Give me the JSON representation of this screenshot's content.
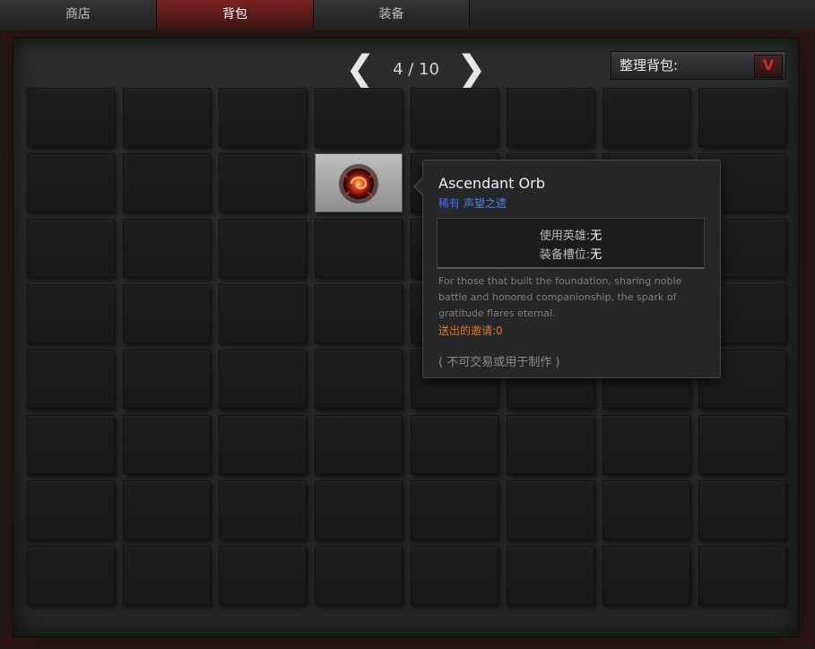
{
  "tabs": [
    {
      "label": "商店",
      "active": false
    },
    {
      "label": "背包",
      "active": true
    },
    {
      "label": "装备",
      "active": false
    }
  ],
  "pager": {
    "prev": "❮",
    "next": "❯",
    "label": "4 / 10"
  },
  "sort": {
    "label": "整理背包:",
    "button": "V"
  },
  "grid": {
    "columns": 8,
    "rows": 8,
    "item_cell": {
      "row": 2,
      "col": 4
    }
  },
  "tooltip": {
    "title": "Ascendant Orb",
    "rarity": "稀有",
    "collection": "声望之遗",
    "hero_label": "使用英雄:",
    "hero_value": "无",
    "slot_label": "装备槽位:",
    "slot_value": "无",
    "description": "For those that built the foundation, sharing noble battle and honored companionship, the spark of gratitude flares eternal.",
    "invite": "送出的邀请:0",
    "note": "( 不可交易或用于制作 )"
  },
  "colors": {
    "rarity": "#4b69ff",
    "accent_red": "#7a2320",
    "invite": "#e0782e"
  }
}
